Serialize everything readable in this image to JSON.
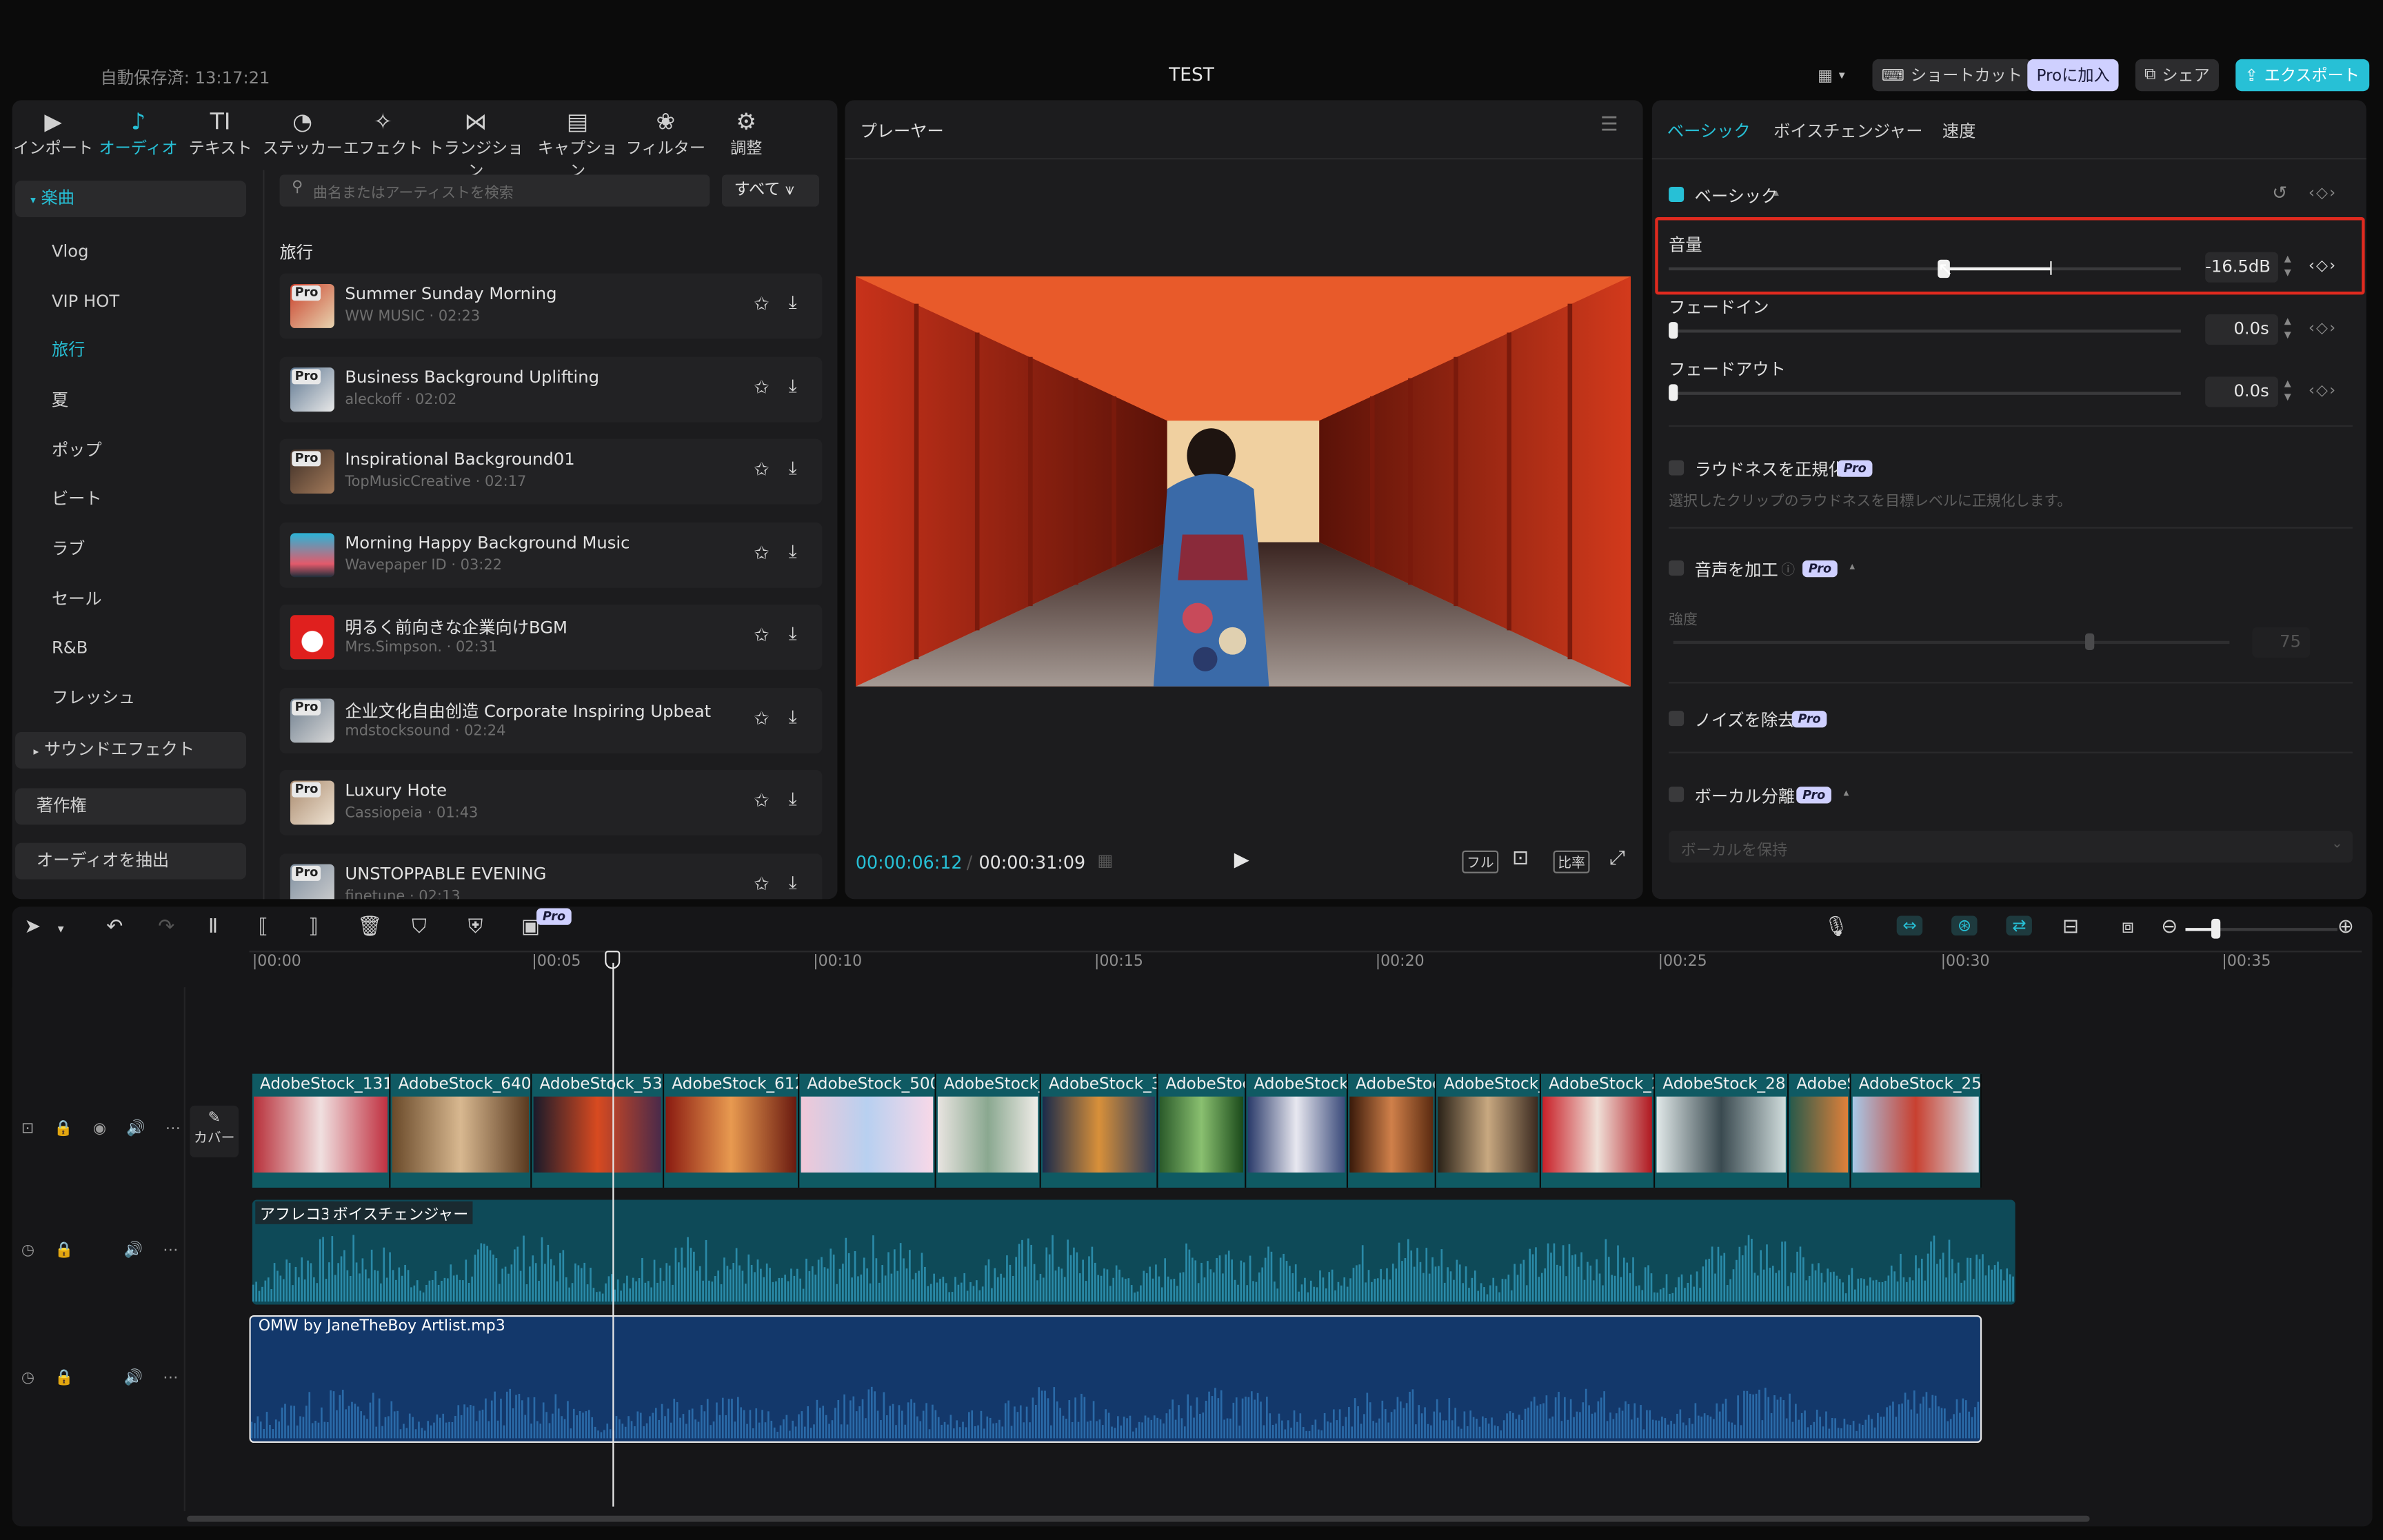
{
  "app": {
    "autosave": "自動保存済: 13:17:21",
    "project_title": "TEST",
    "shortcut_label": "ショートカット",
    "pro_join_label": "Proに加入",
    "share_label": "シェア",
    "export_label": "エクスポート"
  },
  "toolbar": {
    "items": [
      {
        "label": "インポート",
        "icon": "import-icon"
      },
      {
        "label": "オーディオ",
        "icon": "audio-icon"
      },
      {
        "label": "テキスト",
        "icon": "text-icon",
        "glyph": "TI"
      },
      {
        "label": "ステッカー",
        "icon": "sticker-icon"
      },
      {
        "label": "エフェクト",
        "icon": "effect-icon"
      },
      {
        "label": "トランジション",
        "icon": "transition-icon"
      },
      {
        "label": "キャプション",
        "icon": "caption-icon"
      },
      {
        "label": "フィルター",
        "icon": "filter-icon"
      },
      {
        "label": "調整",
        "icon": "adjust-icon"
      }
    ]
  },
  "sidebar": {
    "music_label": "楽曲",
    "items": [
      "Vlog",
      "VIP HOT",
      "旅行",
      "夏",
      "ポップ",
      "ビート",
      "ラブ",
      "セール",
      "R&B",
      "フレッシュ"
    ],
    "sound_effects_label": "サウンドエフェクト",
    "copyright_label": "著作権",
    "extract_audio_label": "オーディオを抽出"
  },
  "library": {
    "search_placeholder": "曲名またはアーティストを検索",
    "filter_label": "すべて",
    "section_title": "旅行",
    "songs": [
      {
        "name": "Summer Sunday Morning",
        "meta": "WW MUSIC · 02:23",
        "pro": "Pro"
      },
      {
        "name": "Business Background Uplifting",
        "meta": "aleckoff · 02:02",
        "pro": "Pro"
      },
      {
        "name": "Inspirational Background01",
        "meta": "TopMusicCreative · 02:17",
        "pro": "Pro"
      },
      {
        "name": "Morning Happy Background Music",
        "meta": "Wavepaper ID · 03:22",
        "pro": ""
      },
      {
        "name": "明るく前向きな企業向けBGM",
        "meta": "Mrs.Simpson. · 02:31",
        "pro": ""
      },
      {
        "name": "企业文化自由创造 Corporate Inspiring Upbeat",
        "meta": "mdstocksound · 02:24",
        "pro": "Pro"
      },
      {
        "name": "Luxury Hote",
        "meta": "Cassiopeia · 01:43",
        "pro": "Pro"
      },
      {
        "name": "UNSTOPPABLE EVENING",
        "meta": "finetune · 02:13",
        "pro": "Pro"
      }
    ]
  },
  "player": {
    "title": "プレーヤー",
    "current_time": "00:00:06:12",
    "total_time": "00:00:31:09",
    "full_label": "フル",
    "ratio_label": "比率"
  },
  "inspector": {
    "tabs": [
      "ベーシック",
      "ボイスチェンジャー",
      "速度"
    ],
    "basic_label": "ベーシック",
    "volume_label": "音量",
    "volume_value": "-16.5dB",
    "fadein_label": "フェードイン",
    "fadein_value": "0.0s",
    "fadeout_label": "フェードアウト",
    "fadeout_value": "0.0s",
    "loudness_label": "ラウドネスを正規化",
    "loudness_desc": "選択したクリップのラウドネスを目標レベルに正規化します。",
    "enhance_label": "音声を加工",
    "strength_label": "強度",
    "strength_value": "75",
    "noise_label": "ノイズを除去",
    "vocal_label": "ボーカル分離",
    "vocal_select": "ボーカルを保持",
    "pro_badge": "Pro"
  },
  "timeline": {
    "ruler": [
      "|00:00",
      "|00:05",
      "|00:10",
      "|00:15",
      "|00:20",
      "|00:25",
      "|00:30",
      "|00:35"
    ],
    "cover_label": "カバー",
    "pro_badge": "Pro",
    "video_clips": [
      "AdobeStock_131",
      "AdobeStock_640",
      "AdobeStock_53:",
      "AdobeStock_612",
      "AdobeStock_500",
      "AdobeStock_",
      "AdobeStock_3",
      "AdobeStoc",
      "AdobeStock_",
      "AdobeStoc",
      "AdobeStock_",
      "AdobeStock_2",
      "AdobeStock_281",
      "AdobeS",
      "AdobeStock_25!"
    ],
    "voice_clip": {
      "name": "アフレコ3",
      "effect": "ボイスチェンジャー"
    },
    "music_clip": "OMW by JaneTheBoy Artlist.mp3"
  },
  "colors": {
    "accent": "#27c0d6",
    "highlight": "#e02a1f",
    "clip": "#0f5a63",
    "music_clip": "#13386b"
  }
}
